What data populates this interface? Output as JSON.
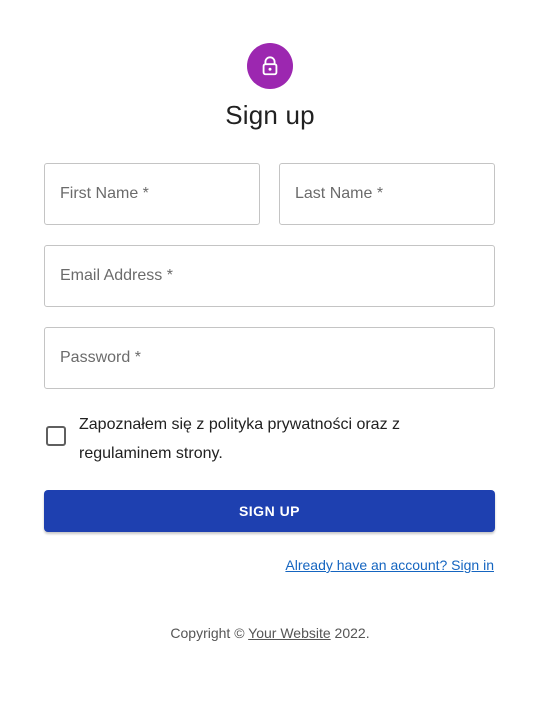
{
  "header": {
    "icon": "lock-icon",
    "avatar_color": "#9c27b0",
    "title": "Sign up"
  },
  "form": {
    "first_name_label": "First Name *",
    "last_name_label": "Last Name *",
    "email_label": "Email Address *",
    "password_label": "Password *",
    "consent_text": "Zapoznałem się z polityka prywatności oraz z regulaminem strony.",
    "consent_checked": false,
    "submit_label": "SIGN UP",
    "submit_color": "#1e40b0"
  },
  "footer": {
    "signin_link": "Already have an account? Sign in",
    "copyright_prefix": "Copyright ©",
    "copyright_link": "Your Website",
    "copyright_suffix": "2022."
  }
}
